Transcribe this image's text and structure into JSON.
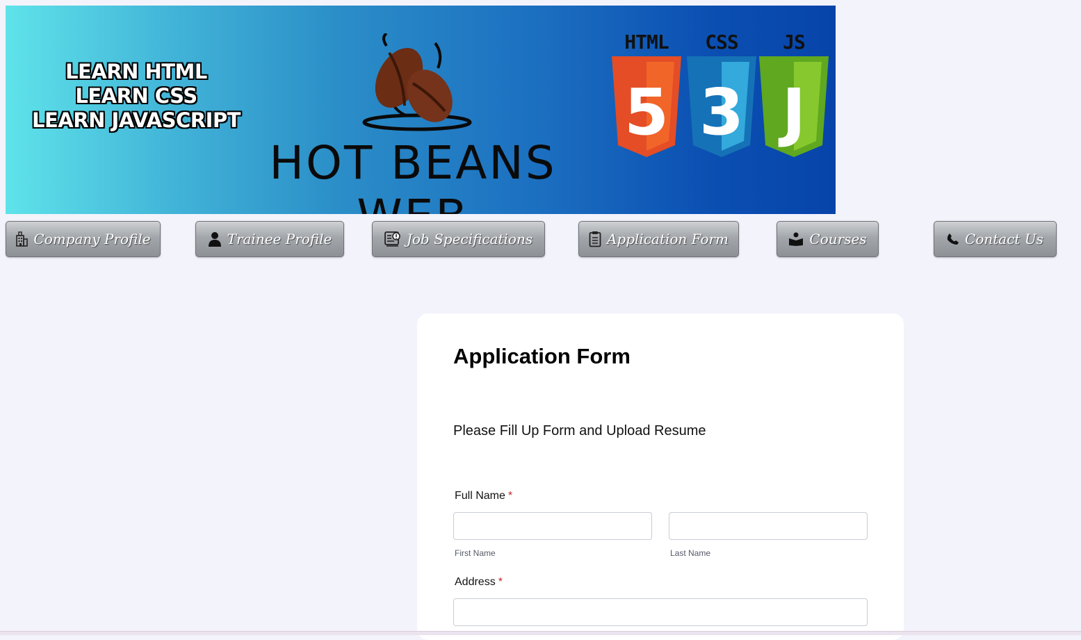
{
  "banner": {
    "learn_lines": [
      "LEARN HTML",
      "LEARN CSS",
      "LEARN JAVASCRIPT"
    ],
    "brand": "HOT BEANS WEB",
    "tech": [
      {
        "label": "HTML",
        "digit": "5",
        "color": "#e44d26",
        "shade": "#f16529"
      },
      {
        "label": "CSS",
        "digit": "3",
        "color": "#1572b6",
        "shade": "#33a9dc"
      },
      {
        "label": "JS",
        "digit": "J",
        "color": "#5fa81f",
        "shade": "#86c82e"
      }
    ]
  },
  "nav": {
    "items": [
      {
        "label": "Company Profile",
        "icon": "building-icon"
      },
      {
        "label": "Trainee Profile",
        "icon": "person-icon"
      },
      {
        "label": "Job Specifications",
        "icon": "job-spec-icon"
      },
      {
        "label": "Application Form",
        "icon": "clipboard-icon"
      },
      {
        "label": "Courses",
        "icon": "reader-icon"
      },
      {
        "label": "Contact Us",
        "icon": "phone-icon"
      }
    ]
  },
  "form": {
    "title": "Application Form",
    "subtitle": "Please Fill Up Form and Upload Resume",
    "full_name_label": "Full Name",
    "required_mark": "*",
    "first_name_value": "",
    "last_name_value": "",
    "first_name_sublabel": "First Name",
    "last_name_sublabel": "Last Name",
    "address_label": "Address",
    "address_value": ""
  },
  "colors": {
    "page_bg": "#f3f3fc",
    "required": "#c0262d"
  }
}
